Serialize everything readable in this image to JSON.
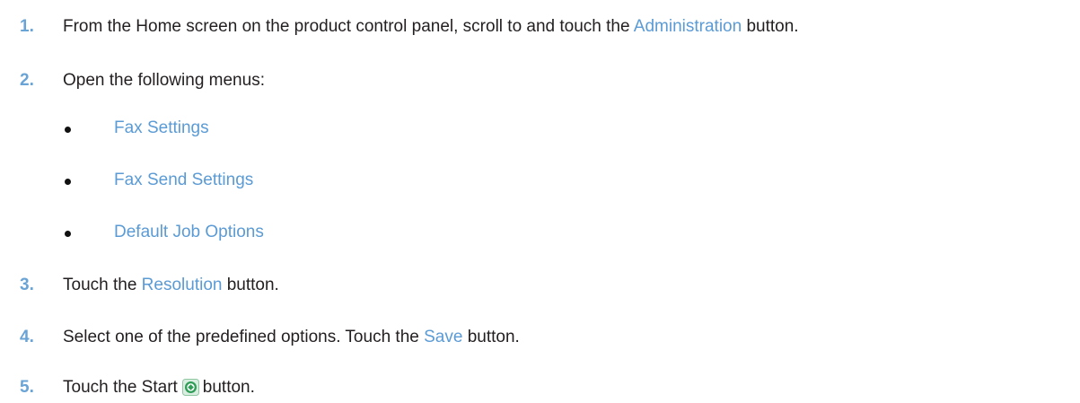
{
  "steps": [
    {
      "number": "1.",
      "before": "From the Home screen on the product control panel, scroll to and touch the ",
      "link": "Administration",
      "after": " button."
    },
    {
      "number": "2.",
      "text": "Open the following menus:",
      "bullets": [
        "Fax Settings",
        "Fax Send Settings",
        "Default Job Options"
      ]
    },
    {
      "number": "3.",
      "before": "Touch the ",
      "link": "Resolution",
      "after": " button."
    },
    {
      "number": "4.",
      "before": "Select one of the predefined options. Touch the ",
      "link": "Save",
      "after": " button."
    },
    {
      "number": "5.",
      "before": "Touch the Start",
      "icon": "start-button-icon",
      "after": "button."
    }
  ],
  "colors": {
    "step_number": "#6aa3d5",
    "link": "#5b9bd5",
    "body_text": "#231f20",
    "start_icon_ring": "#2e9e57"
  }
}
